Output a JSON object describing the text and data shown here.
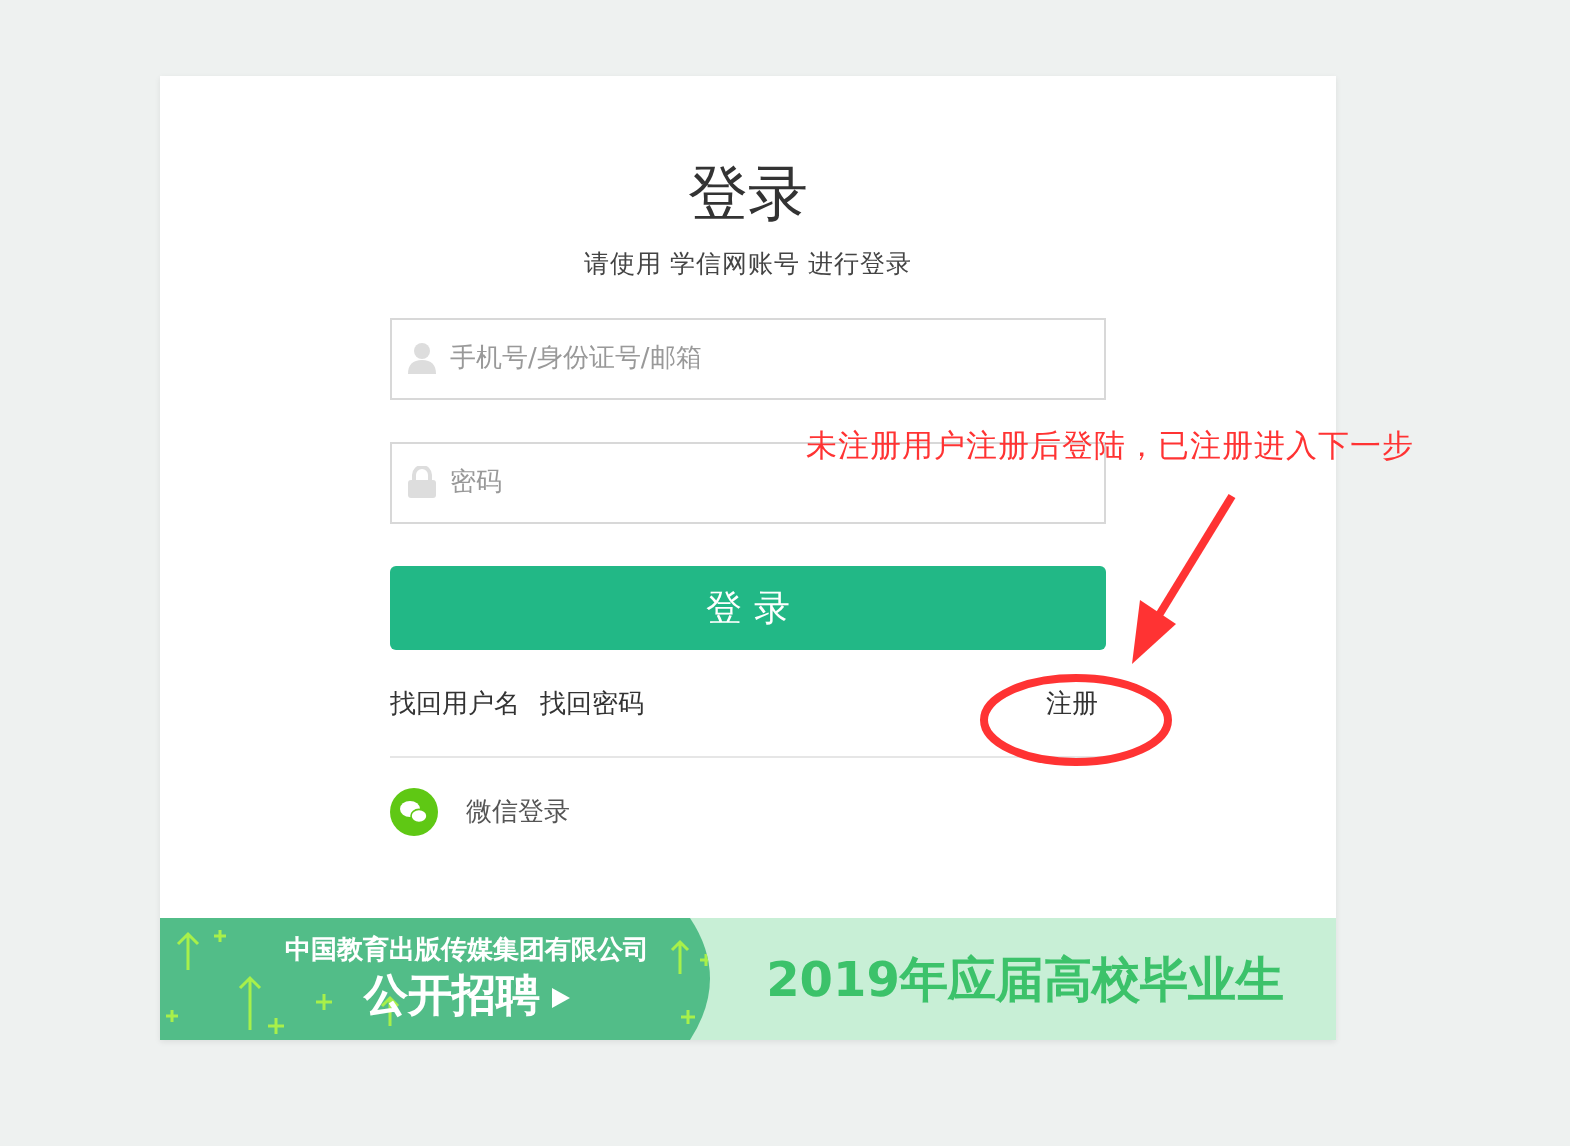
{
  "login": {
    "title": "登录",
    "subtitle": "请使用 学信网账号 进行登录",
    "fields": [
      {
        "kind": "user",
        "placeholder": "手机号/身份证号/邮箱"
      },
      {
        "kind": "password",
        "placeholder": "密码"
      }
    ],
    "submit": "登 录",
    "links": [
      "找回用户名",
      "找回密码"
    ],
    "register": "注册",
    "wechat": "微信登录"
  },
  "banner": {
    "company": "中国教育出版传媒集团有限公司",
    "action": "公开招聘",
    "headline": "2019年应届高校毕业生"
  },
  "annotation": {
    "text": "未注册用户注册后登陆，已注册进入下一步"
  }
}
